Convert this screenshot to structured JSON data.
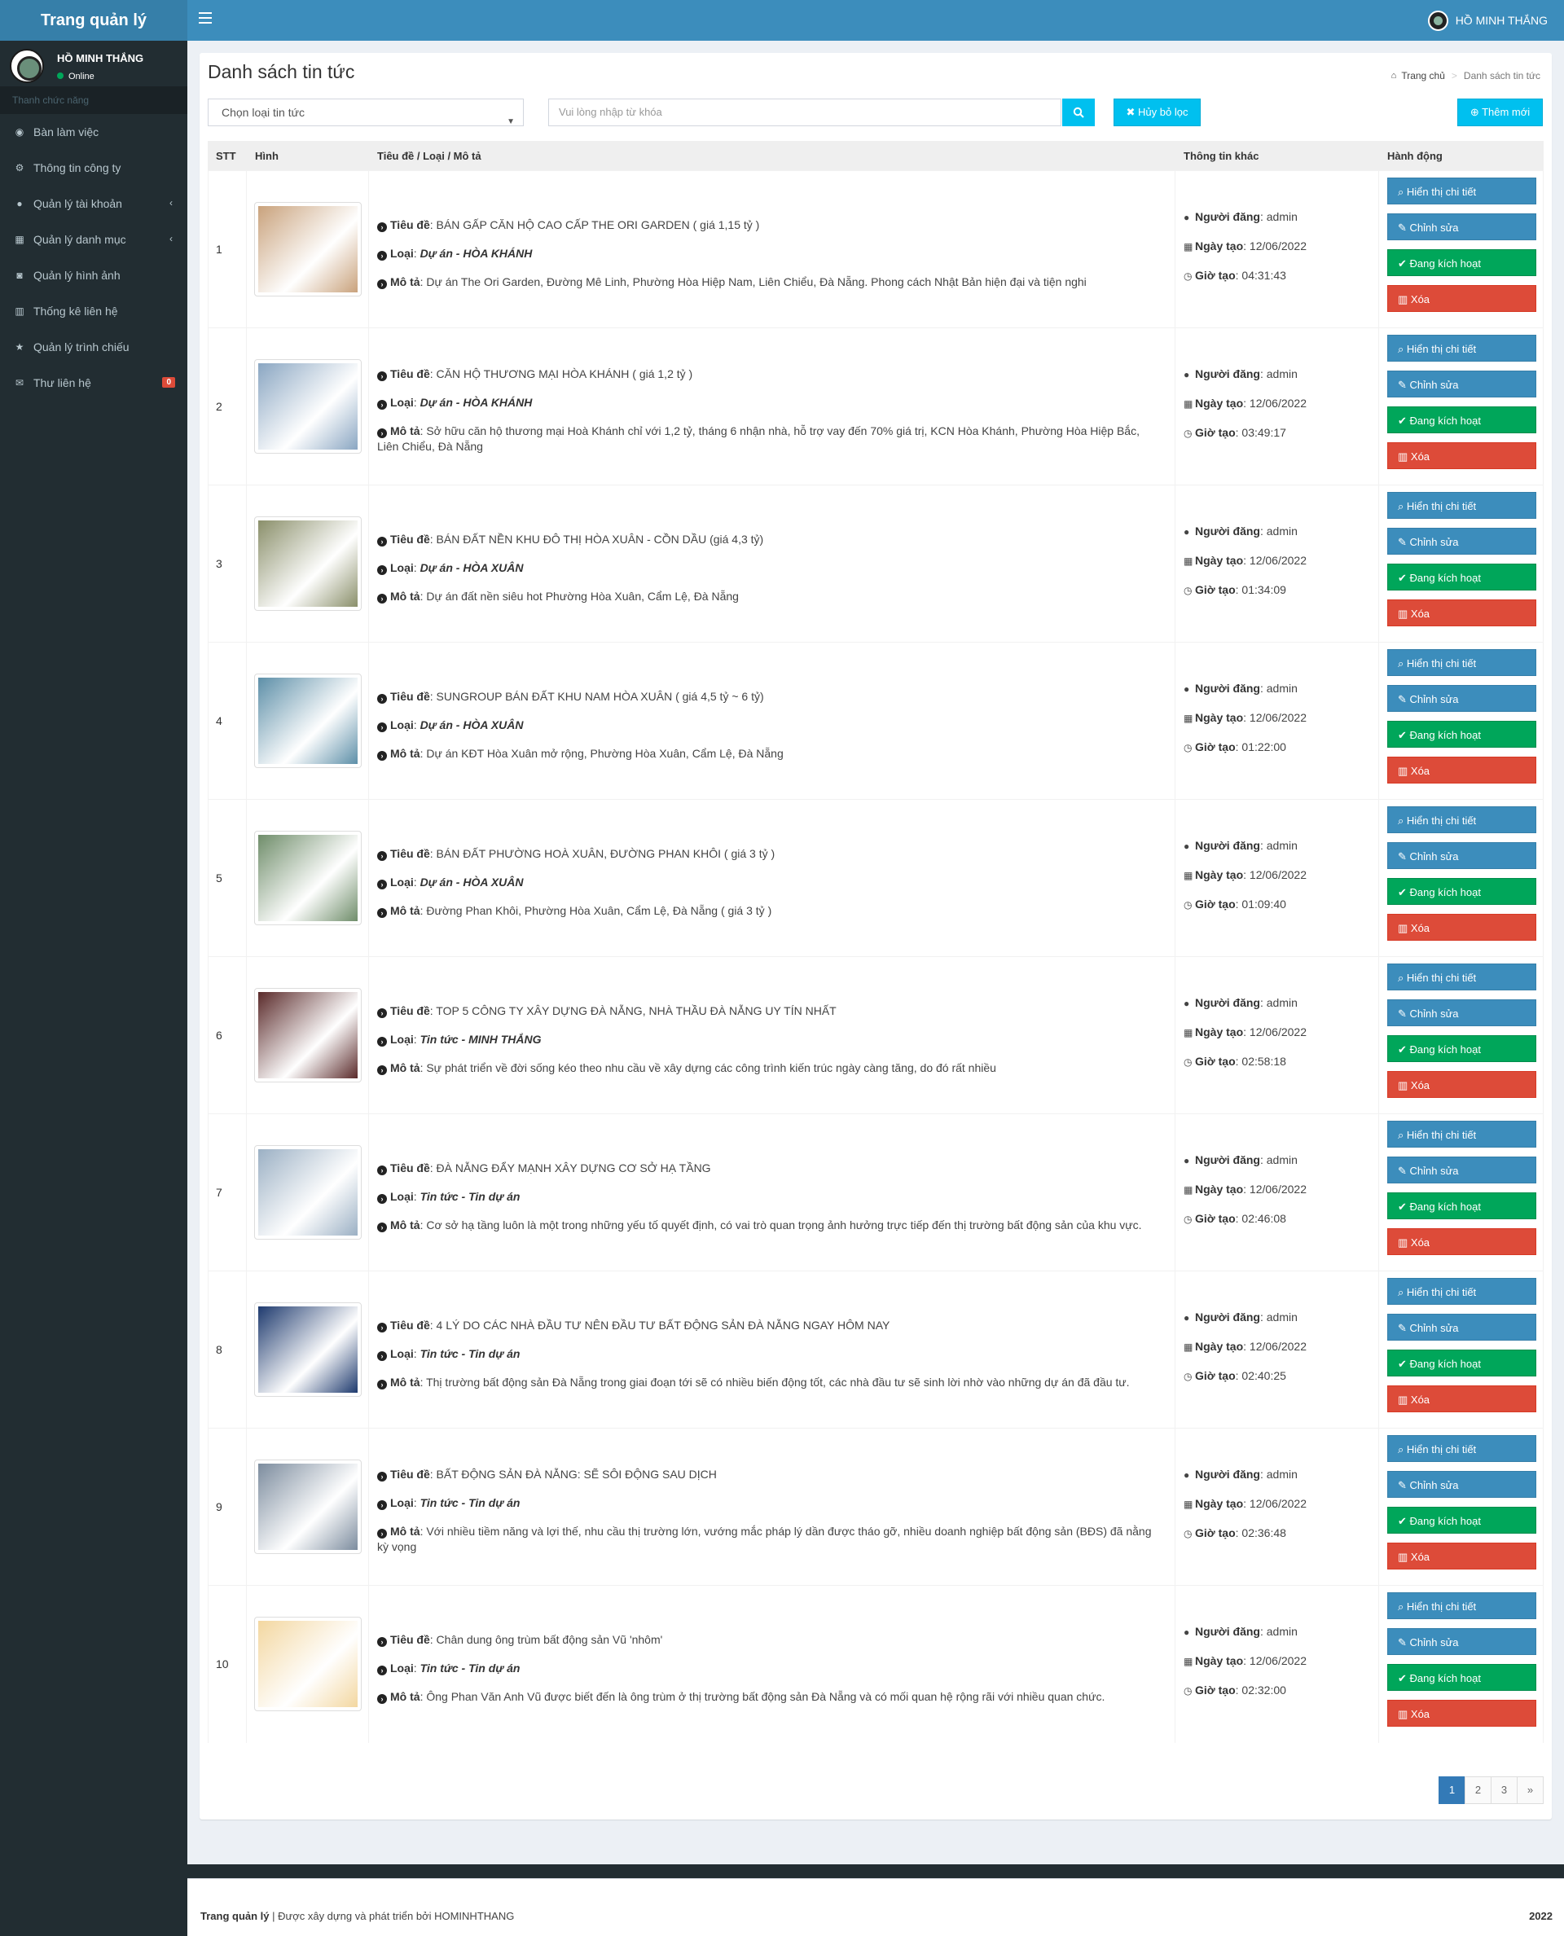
{
  "app": {
    "logo": "Trang quản lý",
    "user": "HỒ MINH THẮNG",
    "status": "Online"
  },
  "sidebar": {
    "header": "Thanh chức năng",
    "items": [
      {
        "label": "Bàn làm việc",
        "icon": "dashboard-icon"
      },
      {
        "label": "Thông tin công ty",
        "icon": "cogs-icon"
      },
      {
        "label": "Quản lý tài khoản",
        "icon": "user-icon",
        "chevron": true
      },
      {
        "label": "Quản lý danh mục",
        "icon": "grid-icon",
        "chevron": true
      },
      {
        "label": "Quản lý hình ảnh",
        "icon": "camera-icon"
      },
      {
        "label": "Thống kê liên hệ",
        "icon": "bar-chart-icon"
      },
      {
        "label": "Quản lý trình chiếu",
        "icon": "star-icon"
      },
      {
        "label": "Thư liên hệ",
        "icon": "envelope-icon",
        "badge": "0"
      }
    ]
  },
  "page": {
    "title": "Danh sách tin tức",
    "breadcrumb_home": "Trang chủ",
    "breadcrumb_current": "Danh sách tin tức"
  },
  "filters": {
    "type_select": "Chọn loại tin tức",
    "search_placeholder": "Vui lòng nhập từ khóa",
    "clear_label": "Hủy bỏ lọc",
    "add_label": "Thêm mới"
  },
  "table": {
    "headers": {
      "stt": "STT",
      "image": "Hình",
      "title": "Tiêu đề / Loại / Mô tả",
      "other": "Thông tin khác",
      "actions": "Hành động"
    },
    "labels": {
      "title": "Tiêu đề",
      "type": "Loại",
      "desc": "Mô tả",
      "author": "Người đăng",
      "date": "Ngày tạo",
      "time": "Giờ tạo"
    },
    "action_labels": {
      "view": "Hiển thị chi tiết",
      "edit": "Chỉnh sửa",
      "active": "Đang kích hoạt",
      "delete": "Xóa"
    },
    "rows": [
      {
        "stt": "1",
        "title": "BÁN GẤP CĂN HỘ CAO CẤP THE ORI GARDEN ( giá 1,15 tỷ )",
        "type": "Dự án - HÒA KHÁNH",
        "desc": "Dự án The Ori Garden, Đường Mê Linh, Phường Hòa Hiệp Nam, Liên Chiểu, Đà Nẵng. Phong cách Nhật Bản hiện đại và tiện nghi",
        "author": "admin",
        "date": "12/06/2022",
        "time": "04:31:43",
        "img": "#c9a27c"
      },
      {
        "stt": "2",
        "title": "CĂN HỘ THƯƠNG MẠI HÒA KHÁNH ( giá 1,2 tỷ )",
        "type": "Dự án - HÒA KHÁNH",
        "desc": "Sở hữu căn hộ thương mại Hoà Khánh chỉ với 1,2 tỷ, tháng 6 nhận nhà, hỗ trợ vay đến 70% giá trị, KCN Hòa Khánh, Phường Hòa Hiệp Bắc, Liên Chiểu, Đà Nẵng",
        "author": "admin",
        "date": "12/06/2022",
        "time": "03:49:17",
        "img": "#8aa6c2"
      },
      {
        "stt": "3",
        "title": "BÁN ĐẤT NỀN KHU ĐÔ THỊ HÒA XUÂN - CỒN DẦU (giá 4,3 tỷ)",
        "type": "Dự án - HÒA XUÂN",
        "desc": "Dự án đất nền siêu hot Phường Hòa Xuân, Cẩm Lệ, Đà Nẵng",
        "author": "admin",
        "date": "12/06/2022",
        "time": "01:34:09",
        "img": "#8a8f6a"
      },
      {
        "stt": "4",
        "title": "SUNGROUP BÁN ĐẤT KHU NAM HÒA XUÂN ( giá 4,5 tỷ ~ 6 tỷ)",
        "type": "Dự án - HÒA XUÂN",
        "desc": "Dự án KĐT Hòa Xuân mở rộng, Phường Hòa Xuân, Cẩm Lệ, Đà Nẵng",
        "author": "admin",
        "date": "12/06/2022",
        "time": "01:22:00",
        "img": "#5d8fa8"
      },
      {
        "stt": "5",
        "title": "BÁN ĐẤT PHƯỜNG HOÀ XUÂN, ĐƯỜNG PHAN KHÔI ( giá 3 tỷ )",
        "type": "Dự án - HÒA XUÂN",
        "desc": "Đường Phan Khôi, Phường Hòa Xuân, Cẩm Lệ, Đà Nẵng ( giá 3 tỷ )",
        "author": "admin",
        "date": "12/06/2022",
        "time": "01:09:40",
        "img": "#6f8d6a"
      },
      {
        "stt": "6",
        "title": "TOP 5 CÔNG TY XÂY DỰNG ĐÀ NẴNG, NHÀ THẦU ĐÀ NẴNG UY TÍN NHẤT",
        "type": "Tin tức - MINH THẮNG",
        "desc": "Sự phát triển về đời sống kéo theo nhu cầu về xây dựng các công trình kiến trúc ngày càng tăng, do đó rất nhiều",
        "author": "admin",
        "date": "12/06/2022",
        "time": "02:58:18",
        "img": "#5a2a2a"
      },
      {
        "stt": "7",
        "title": "ĐÀ NẴNG ĐẨY MẠNH XÂY DỰNG CƠ SỞ HẠ TẦNG",
        "type": "Tin tức - Tin dự án",
        "desc": "Cơ sở hạ tầng luôn là một trong những yếu tố quyết định, có vai trò quan trọng ảnh hưởng trực tiếp đến thị trường bất động sản của khu vực.",
        "author": "admin",
        "date": "12/06/2022",
        "time": "02:46:08",
        "img": "#9bb0c4"
      },
      {
        "stt": "8",
        "title": "4 LÝ DO CÁC NHÀ ĐẦU TƯ NÊN ĐẦU TƯ BẤT ĐỘNG SẢN ĐÀ NẴNG NGAY HÔM NAY",
        "type": "Tin tức - Tin dự án",
        "desc": "Thị trường bất động sản Đà Nẵng trong giai đoạn tới sẽ có nhiều biến động tốt, các nhà đầu tư sẽ sinh lời nhờ vào những dự án đã đầu tư.",
        "author": "admin",
        "date": "12/06/2022",
        "time": "02:40:25",
        "img": "#1e3a6e"
      },
      {
        "stt": "9",
        "title": "BẤT ĐỘNG SẢN ĐÀ NẴNG: SẼ SÔI ĐỘNG SAU DỊCH",
        "type": "Tin tức - Tin dự án",
        "desc": "Với nhiều tiềm năng và lợi thế, nhu cầu thị trường lớn, vướng mắc pháp lý dần được tháo gỡ, nhiều doanh nghiệp bất động sản (BĐS) đã nằng kỳ vọng",
        "author": "admin",
        "date": "12/06/2022",
        "time": "02:36:48",
        "img": "#7c8c9e"
      },
      {
        "stt": "10",
        "title": "Chân dung ông trùm bất động sản Vũ 'nhôm'",
        "type": "Tin tức - Tin dự án",
        "desc": "Ông Phan Văn Anh Vũ được biết đến là ông trùm ở thị trường bất động sản Đà Nẵng và có mối quan hệ rộng rãi với nhiều quan chức.",
        "author": "admin",
        "date": "12/06/2022",
        "time": "02:32:00",
        "img": "#f3d7a0"
      }
    ]
  },
  "pagination": [
    "1",
    "2",
    "3",
    "»"
  ],
  "footer": {
    "left_brand": "Trang quản lý",
    "left_text": " | Được xây dựng và phát triển bởi HOMINHTHANG",
    "year": "2022"
  },
  "colors": {
    "primary": "#3c8dbc",
    "sidebar": "#222d32",
    "info": "#00c0ef",
    "success": "#00a65a",
    "danger": "#dd4b39"
  }
}
